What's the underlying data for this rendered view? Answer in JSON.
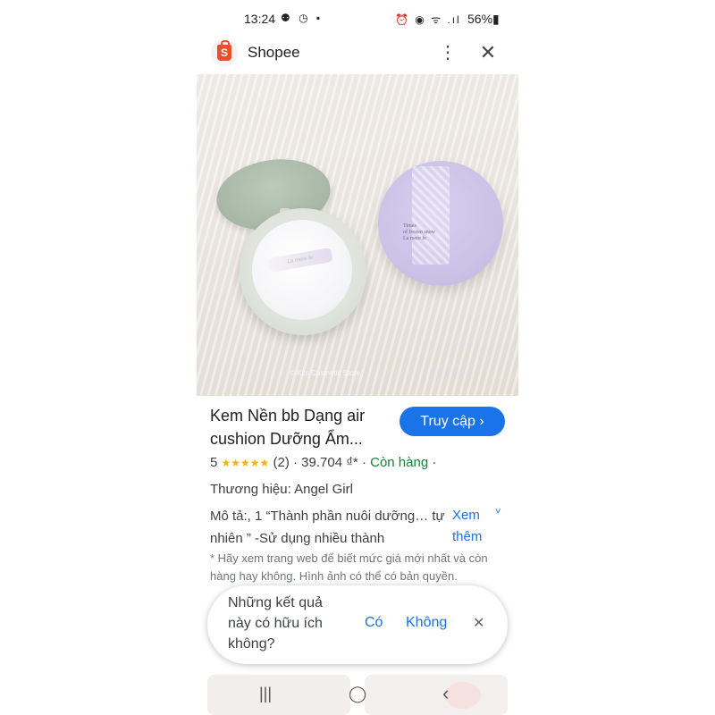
{
  "status_bar": {
    "time": "13:24",
    "left_icons": "⚉ ◷ ▪",
    "right_icons": "⏰ ◉ ᯤ .ıl",
    "battery": "56%▮"
  },
  "app_bar": {
    "title": "Shopee",
    "menu_icon": "⋮",
    "close_icon": "✕",
    "logo_letter": "S"
  },
  "hero": {
    "strap_text": "La mere fe",
    "lid_text": "Times\nof frozen snow\nLa mere fe",
    "watermark": "© Kim Cosmetic Store"
  },
  "result": {
    "title": "Kem Nền bb Dạng air cushion Dưỡng Ẩm...",
    "visit_button": "Truy cập ›",
    "rating": "5",
    "stars": "★★★★★",
    "review_count": "(2)",
    "sep1": "·",
    "price": "39.704 ₫*",
    "sep2": "·",
    "stock": "Còn hàng",
    "sep3": "·",
    "brand": "Thương hiệu: Angel Girl",
    "description": "Mô tả:, 1 “Thành phần nuôi dưỡng… tự nhiên ” -Sử dụng nhiều thành",
    "more_label": "Xem thêm",
    "more_chevron": "˅",
    "note": "* Hãy xem trang web để biết mức giá mới nhất và còn hàng hay không. Hình ảnh có thể có bản quyền."
  },
  "feedback": {
    "question": "Những kết quả này có hữu ích không?",
    "yes": "Có",
    "no": "Không",
    "dismiss": "✕"
  },
  "nav_bar": {
    "recents": "|||",
    "home": "◯",
    "back": "‹"
  }
}
